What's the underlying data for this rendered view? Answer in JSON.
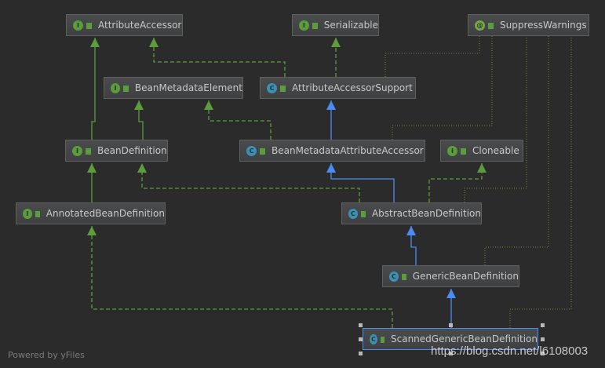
{
  "diagram": {
    "nodes": [
      {
        "id": "AttributeAccessor",
        "label": "AttributeAccessor",
        "kind": "interface",
        "badge": "I"
      },
      {
        "id": "Serializable",
        "label": "Serializable",
        "kind": "interface",
        "badge": "I"
      },
      {
        "id": "SuppressWarnings",
        "label": "SuppressWarnings",
        "kind": "annotation",
        "badge": "@"
      },
      {
        "id": "BeanMetadataElement",
        "label": "BeanMetadataElement",
        "kind": "interface",
        "badge": "I"
      },
      {
        "id": "AttributeAccessorSupport",
        "label": "AttributeAccessorSupport",
        "kind": "abstract-class",
        "badge": "C"
      },
      {
        "id": "BeanDefinition",
        "label": "BeanDefinition",
        "kind": "interface",
        "badge": "I"
      },
      {
        "id": "BeanMetadataAttributeAccessor",
        "label": "BeanMetadataAttributeAccessor",
        "kind": "class",
        "badge": "C"
      },
      {
        "id": "Cloneable",
        "label": "Cloneable",
        "kind": "interface",
        "badge": "I"
      },
      {
        "id": "AnnotatedBeanDefinition",
        "label": "AnnotatedBeanDefinition",
        "kind": "interface",
        "badge": "I"
      },
      {
        "id": "AbstractBeanDefinition",
        "label": "AbstractBeanDefinition",
        "kind": "abstract-class",
        "badge": "C"
      },
      {
        "id": "GenericBeanDefinition",
        "label": "GenericBeanDefinition",
        "kind": "class",
        "badge": "C"
      },
      {
        "id": "ScannedGenericBeanDefinition",
        "label": "ScannedGenericBeanDefinition",
        "kind": "class",
        "badge": "C",
        "selected": true
      }
    ],
    "edges": [
      {
        "from": "BeanDefinition",
        "to": "AttributeAccessor",
        "type": "extends"
      },
      {
        "from": "BeanDefinition",
        "to": "BeanMetadataElement",
        "type": "extends"
      },
      {
        "from": "AttributeAccessorSupport",
        "to": "AttributeAccessor",
        "type": "implements"
      },
      {
        "from": "AttributeAccessorSupport",
        "to": "Serializable",
        "type": "implements"
      },
      {
        "from": "AttributeAccessorSupport",
        "to": "SuppressWarnings",
        "type": "annotated"
      },
      {
        "from": "BeanMetadataAttributeAccessor",
        "to": "AttributeAccessorSupport",
        "type": "inherits"
      },
      {
        "from": "BeanMetadataAttributeAccessor",
        "to": "BeanMetadataElement",
        "type": "implements"
      },
      {
        "from": "BeanMetadataAttributeAccessor",
        "to": "SuppressWarnings",
        "type": "annotated"
      },
      {
        "from": "AbstractBeanDefinition",
        "to": "BeanMetadataAttributeAccessor",
        "type": "inherits"
      },
      {
        "from": "AbstractBeanDefinition",
        "to": "BeanDefinition",
        "type": "implements"
      },
      {
        "from": "AbstractBeanDefinition",
        "to": "Cloneable",
        "type": "implements"
      },
      {
        "from": "AbstractBeanDefinition",
        "to": "SuppressWarnings",
        "type": "annotated"
      },
      {
        "from": "AnnotatedBeanDefinition",
        "to": "BeanDefinition",
        "type": "extends"
      },
      {
        "from": "GenericBeanDefinition",
        "to": "AbstractBeanDefinition",
        "type": "inherits"
      },
      {
        "from": "GenericBeanDefinition",
        "to": "SuppressWarnings",
        "type": "annotated"
      },
      {
        "from": "ScannedGenericBeanDefinition",
        "to": "GenericBeanDefinition",
        "type": "inherits"
      },
      {
        "from": "ScannedGenericBeanDefinition",
        "to": "AnnotatedBeanDefinition",
        "type": "implements"
      },
      {
        "from": "ScannedGenericBeanDefinition",
        "to": "SuppressWarnings",
        "type": "annotated"
      }
    ]
  },
  "colors": {
    "extends": "#5c9c3c",
    "implements": "#5c9c3c",
    "inherits": "#4b8cf0",
    "annotated": "#6a8a3a",
    "interface_badge": "#5c9c3c",
    "class_badge": "#3d8fb5",
    "annotation_badge": "#7aa34a"
  },
  "footer": "Powered by yFiles",
  "watermark": "https://blog.csdn.net/l6108003"
}
